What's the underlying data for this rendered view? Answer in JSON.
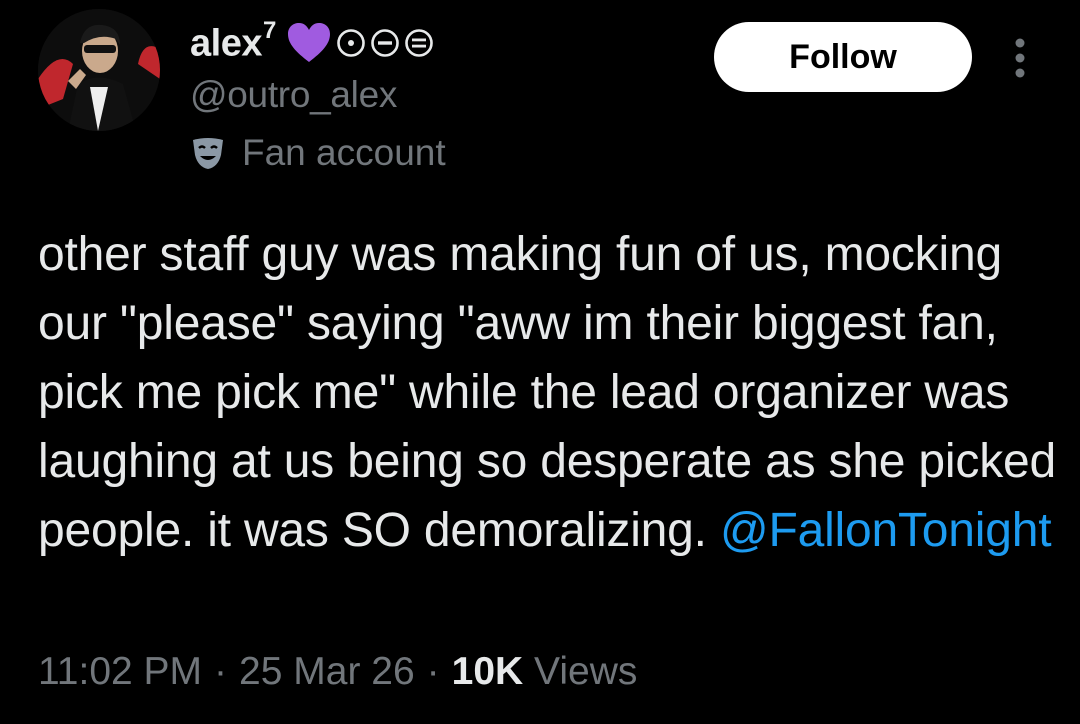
{
  "profile": {
    "display_name": "alex",
    "display_name_sup": "7",
    "handle": "@outro_alex",
    "label": "Fan account",
    "emoji_icons": [
      "purple-heart-icon",
      "circle-dot-icon",
      "circle-minus-icon",
      "circle-equals-icon"
    ]
  },
  "actions": {
    "follow_label": "Follow"
  },
  "tweet": {
    "text": "other staff guy was making fun of us, mocking our \"please\" saying \"aww im their biggest fan, pick me pick me\" while the lead organizer was laughing at us being so desperate as she picked people. it was SO demoralizing. ",
    "mention": "@FallonTonight"
  },
  "meta": {
    "time": "11:02 PM",
    "sep": "·",
    "date": "25 Mar 26",
    "views_count": "10K",
    "views_label": " Views"
  },
  "colors": {
    "background": "#000000",
    "primary_text": "#e7e9ea",
    "secondary_text": "#71767b",
    "link": "#1d9bf0",
    "heart": "#a05be0"
  }
}
